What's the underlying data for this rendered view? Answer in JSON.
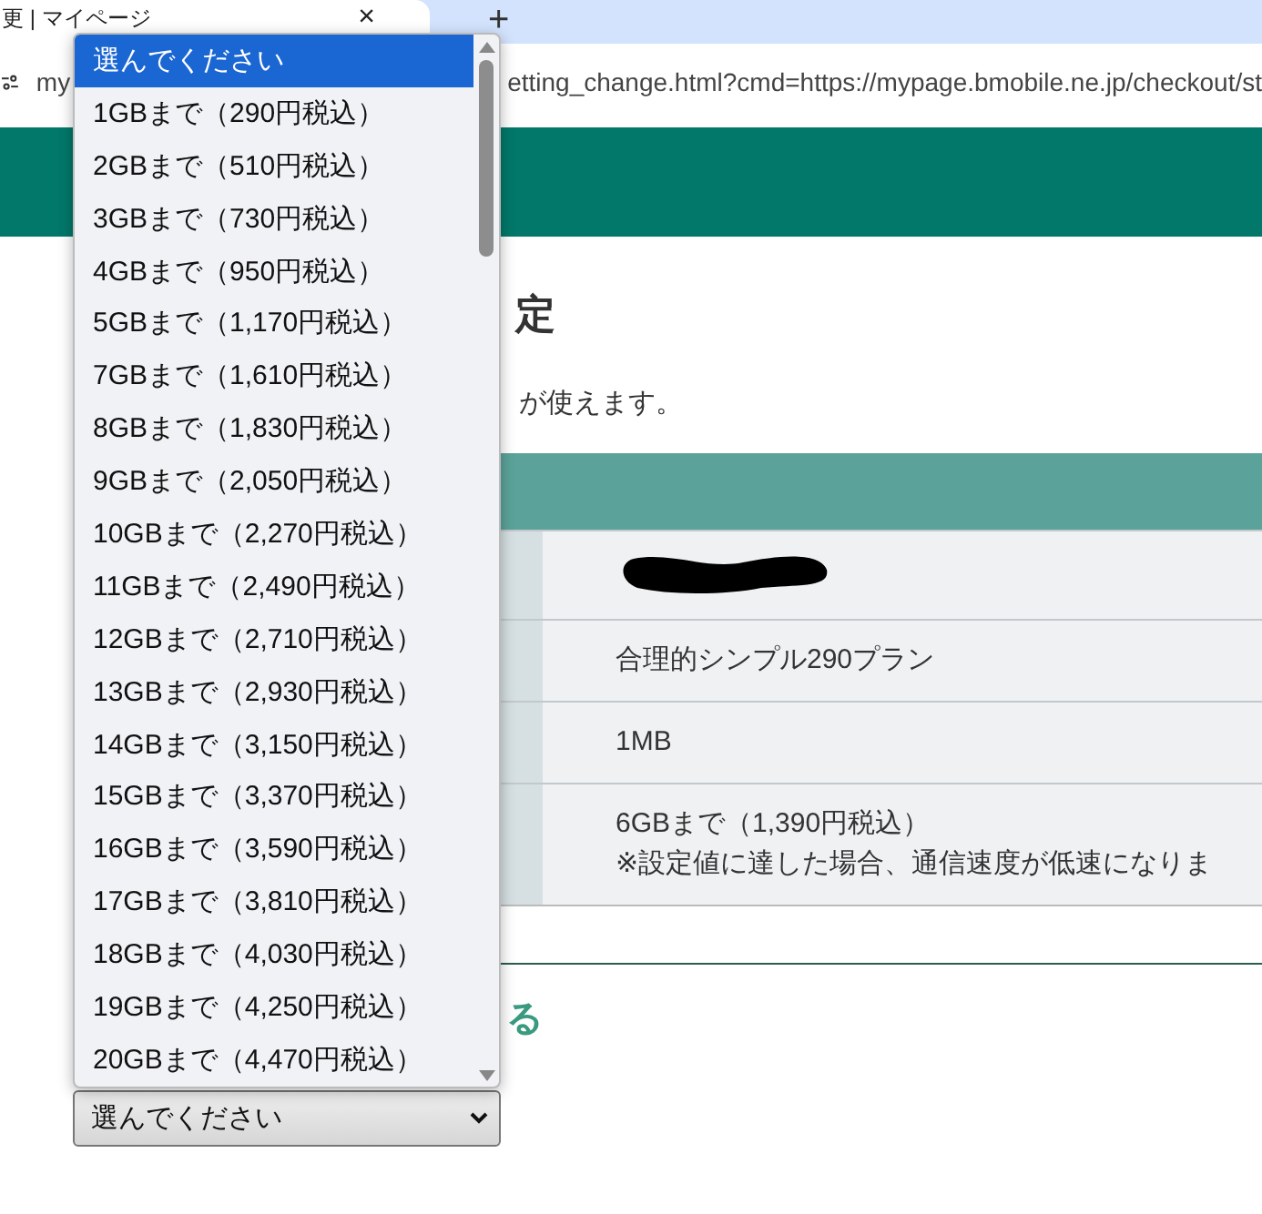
{
  "browser": {
    "tab": {
      "title": "更 | マイページ",
      "close": "×"
    },
    "new_tab": "+",
    "address": {
      "url_start": "my",
      "url_end": "etting_change.html?cmd=https://mypage.bmobile.ne.jp/checkout/st"
    }
  },
  "page": {
    "heading": "定",
    "intro": "が使えます。",
    "table": {
      "rows": [
        {
          "kind": "redacted"
        },
        {
          "kind": "text",
          "lines": [
            "合理的シンプル290プラン"
          ]
        },
        {
          "kind": "text",
          "lines": [
            "1MB"
          ]
        },
        {
          "kind": "text",
          "lines": [
            "6GBまで（1,390円税込）",
            "※設定値に達した場合、通信速度が低速になりま"
          ]
        }
      ]
    },
    "link": "る",
    "select": {
      "value": "選んでください",
      "expanded": true,
      "options": [
        {
          "label": "選んでください",
          "selected": true
        },
        {
          "label": "1GBまで（290円税込）",
          "selected": false
        },
        {
          "label": "2GBまで（510円税込）",
          "selected": false
        },
        {
          "label": "3GBまで（730円税込）",
          "selected": false
        },
        {
          "label": "4GBまで（950円税込）",
          "selected": false
        },
        {
          "label": "5GBまで（1,170円税込）",
          "selected": false
        },
        {
          "label": "7GBまで（1,610円税込）",
          "selected": false
        },
        {
          "label": "8GBまで（1,830円税込）",
          "selected": false
        },
        {
          "label": "9GBまで（2,050円税込）",
          "selected": false
        },
        {
          "label": "10GBまで（2,270円税込）",
          "selected": false
        },
        {
          "label": "11GBまで（2,490円税込）",
          "selected": false
        },
        {
          "label": "12GBまで（2,710円税込）",
          "selected": false
        },
        {
          "label": "13GBまで（2,930円税込）",
          "selected": false
        },
        {
          "label": "14GBまで（3,150円税込）",
          "selected": false
        },
        {
          "label": "15GBまで（3,370円税込）",
          "selected": false
        },
        {
          "label": "16GBまで（3,590円税込）",
          "selected": false
        },
        {
          "label": "17GBまで（3,810円税込）",
          "selected": false
        },
        {
          "label": "18GBまで（4,030円税込）",
          "selected": false
        },
        {
          "label": "19GBまで（4,250円税込）",
          "selected": false
        },
        {
          "label": "20GBまで（4,470円税込）",
          "selected": false
        }
      ]
    }
  }
}
